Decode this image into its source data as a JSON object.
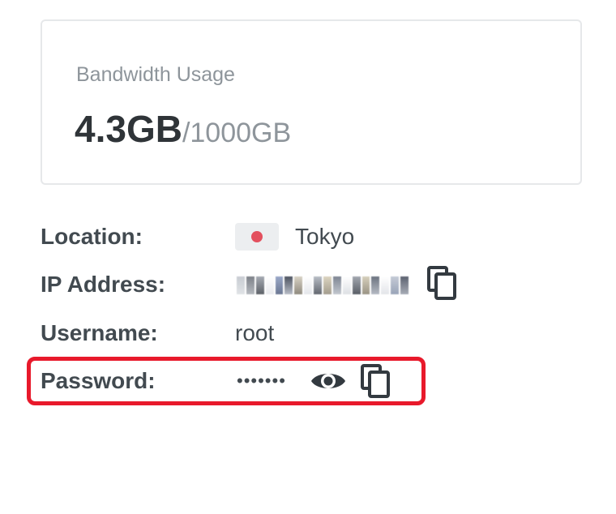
{
  "bandwidth": {
    "label": "Bandwidth Usage",
    "used": "4.3GB",
    "total": "/1000GB"
  },
  "details": {
    "location_label": "Location:",
    "location_value": "Tokyo",
    "ip_label": "IP Address:",
    "username_label": "Username:",
    "username_value": "root",
    "password_label": "Password:",
    "password_value": "•••••••"
  },
  "icons": {
    "flag": "japan-flag-icon",
    "copy": "copy-icon",
    "show_password": "eye-icon"
  },
  "colors": {
    "highlight": "#e8192b",
    "flag_dot": "#e3505e",
    "icon": "#333a40"
  }
}
